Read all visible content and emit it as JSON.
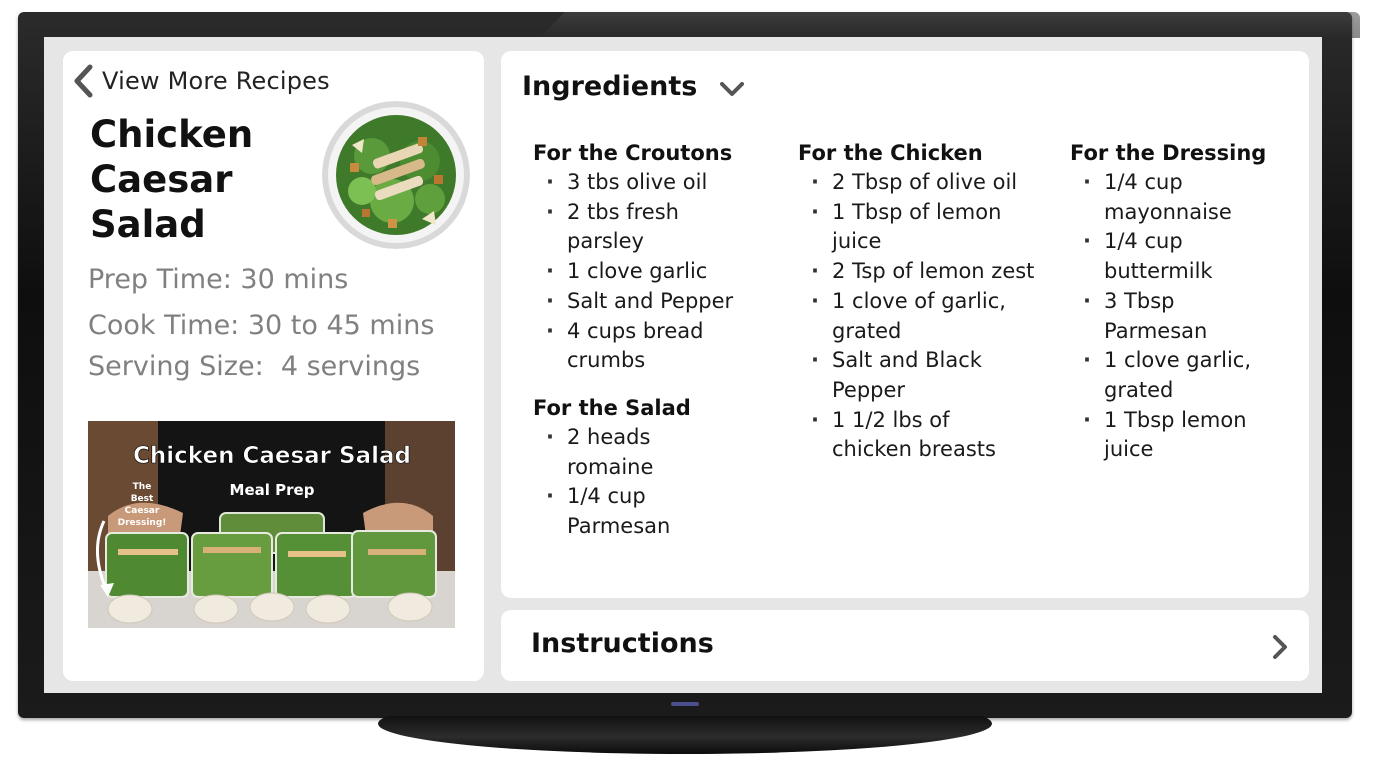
{
  "back_link": {
    "label": "View More Recipes",
    "icon": "chevron-left-icon"
  },
  "recipe": {
    "title": "Chicken Caesar Salad",
    "prep_time": "Prep Time: 30 mins",
    "cook_time": "Cook Time: 30 to 45 mins",
    "serving_size": "Serving Size:  4 servings"
  },
  "video": {
    "title": "Chicken Caesar Salad",
    "subtitle": "Meal Prep",
    "badge": [
      "The",
      "Best",
      "Caesar",
      "Dressing!"
    ]
  },
  "ingredients": {
    "title": "Ingredients",
    "chevron_icon": "chevron-down-icon",
    "groups": [
      {
        "heading": "For the Croutons",
        "items": [
          "3 tbs olive oil",
          "2 tbs fresh parsley",
          "1 clove garlic",
          "Salt and Pepper",
          "4 cups bread crumbs"
        ]
      },
      {
        "heading": "For the Salad",
        "items": [
          "2 heads romaine",
          "1/4 cup Parmesan"
        ]
      },
      {
        "heading": "For the Chicken",
        "items": [
          "2 Tbsp of olive oil",
          "1 Tbsp of lemon juice",
          "2 Tsp of lemon zest",
          "1 clove of garlic, grated",
          "Salt and Black Pepper",
          "1 1/2 lbs of chicken breasts"
        ]
      },
      {
        "heading": "For the Dressing",
        "items": [
          "1/4 cup mayonnaise",
          "1/4 cup buttermilk",
          "3 Tbsp Parmesan",
          "1 clove garlic, grated",
          "1 Tbsp lemon juice"
        ]
      }
    ]
  },
  "instructions": {
    "title": "Instructions",
    "chevron_icon": "chevron-right-icon"
  },
  "colors": {
    "card": "#ffffff",
    "screen": "#e6e6e6",
    "meta_text": "#808080",
    "tv_bezel": "#111111"
  }
}
